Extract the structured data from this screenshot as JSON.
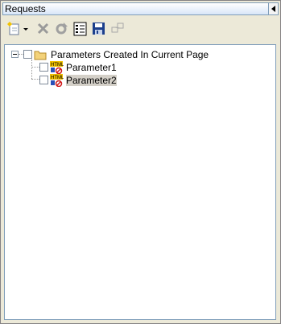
{
  "panel": {
    "title": "Requests"
  },
  "toolbar": {
    "items": [
      {
        "name": "new-icon"
      },
      {
        "name": "dropdown-arrow-icon"
      },
      {
        "name": "delete-icon"
      },
      {
        "name": "refresh-icon"
      },
      {
        "name": "properties-icon"
      },
      {
        "name": "save-icon"
      },
      {
        "name": "link-icon"
      }
    ]
  },
  "tree": {
    "root": {
      "label": "Parameters Created In Current Page",
      "expanded": true,
      "checked": false
    },
    "children": [
      {
        "label": "Parameter1",
        "checked": false
      },
      {
        "label": "Parameter2",
        "checked": false,
        "selected": true
      }
    ]
  },
  "colors": {
    "background": "#ece9d8",
    "title_border": "#7f9db9",
    "tree_background": "#ffffff"
  }
}
